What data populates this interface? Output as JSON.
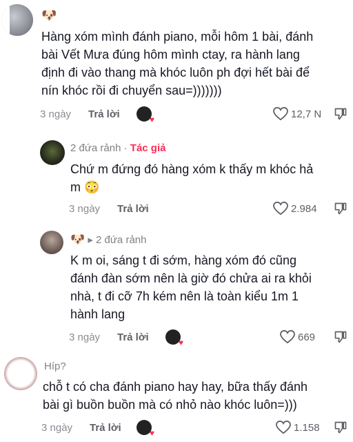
{
  "comments": [
    {
      "emoji": "🐶",
      "text_lines": [
        "Hàng xóm mình đánh piano, mỗi hôm 1 bài, đánh",
        "bài Vết Mưa đúng hôm mình ctay, ra hành lang",
        "định đi vào thang mà khóc luôn ph đợi hết bài để",
        "nín khóc rồi đi chuyển sau=)))))))"
      ],
      "time": "3 ngày",
      "reply_label": "Trả lời",
      "likes": "12,7 N"
    },
    {
      "name": "2 đứa rảnh",
      "separator": "·",
      "author_tag": "Tác giả",
      "text_lines": [
        "Chứ m đứng đó hàng xóm k thấy m khóc hả",
        "m 😳"
      ],
      "time": "3 ngày",
      "reply_label": "Trả lời",
      "likes": "2.984"
    },
    {
      "emoji": "🐶",
      "reply_to": "▸ 2 đứa rảnh",
      "text_lines": [
        "K m oi, sáng t đi sớm, hàng xóm đó cũng",
        "đánh đàn sớm nên là giờ đó chửa ai ra khỏi",
        "nhà, t đi cỡ 7h kém nên là toàn kiểu 1m 1",
        "hành lang"
      ],
      "time": "3 ngày",
      "reply_label": "Trả lời",
      "likes": "669"
    },
    {
      "name": "Híp?",
      "text_lines": [
        "chỗ t có cha đánh piano hay hay, bữa thấy đánh",
        "bài gì buồn buồn mà có nhỏ nào khóc luôn=)))"
      ],
      "time": "3 ngày",
      "reply_label": "Trả lời",
      "likes": "1.158"
    }
  ],
  "icons": {
    "like": "heart-outline-icon",
    "dislike": "thumbs-down-icon",
    "creator_liked": "creator-liked-avatar-icon"
  },
  "colors": {
    "author_tag": "#fe2c55",
    "text": "#161823",
    "meta": "#8a8b91"
  }
}
